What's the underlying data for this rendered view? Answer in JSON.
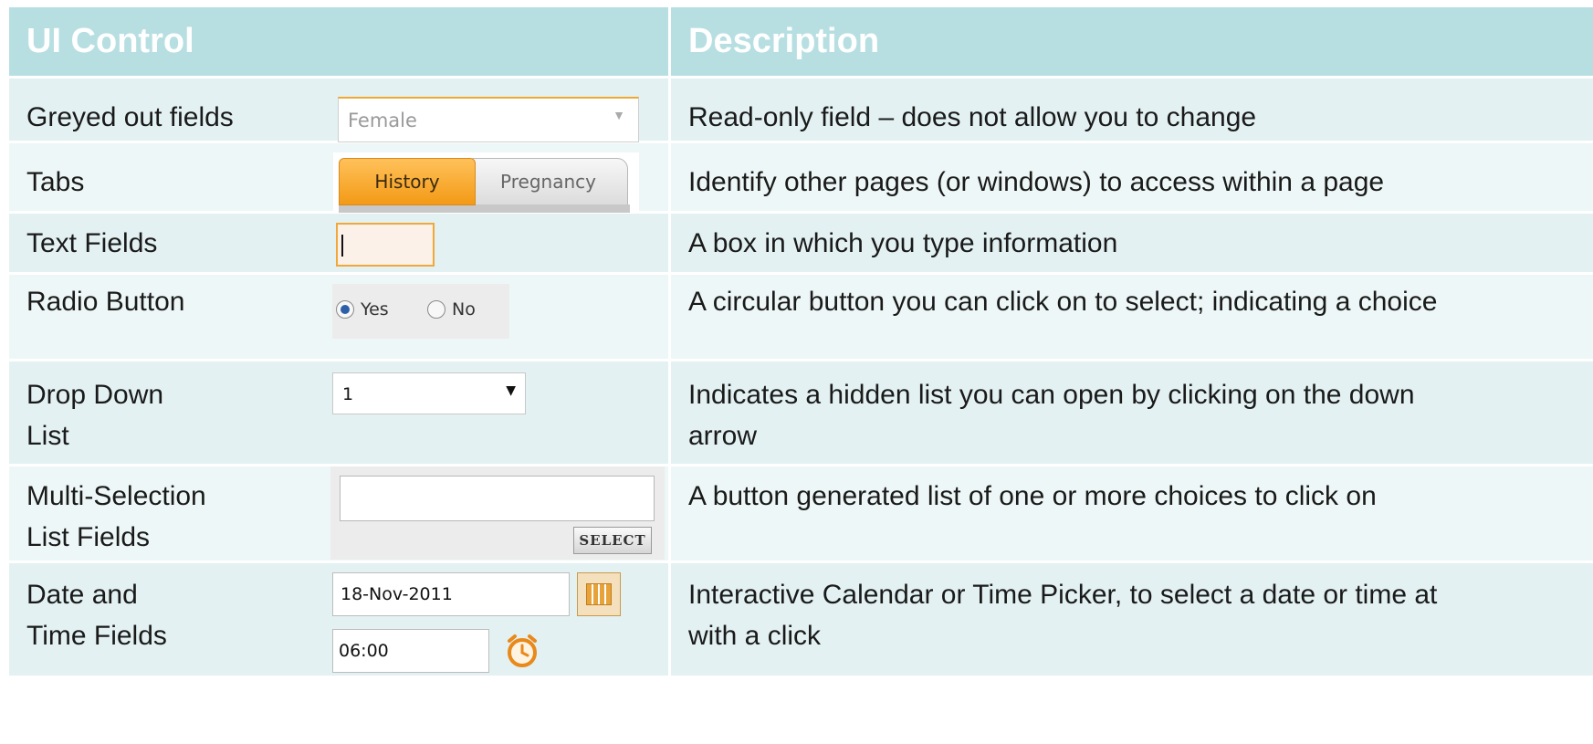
{
  "header": {
    "col1": "UI Control",
    "col2": "Description"
  },
  "rows": [
    {
      "label": "Greyed out fields",
      "desc": "Read-only field – does not allow you to change",
      "widget": {
        "value": "Female",
        "icon": "chevron-down-icon"
      }
    },
    {
      "label": "Tabs",
      "desc": "Identify other pages (or windows) to access within a page",
      "widget": {
        "tab1": "History",
        "tab2": "Pregnancy"
      }
    },
    {
      "label": "Text Fields",
      "desc": "A box in which you type information",
      "widget": {
        "value": ""
      }
    },
    {
      "label": "Radio Button",
      "desc": "A circular button you can click on to select; indicating a choice",
      "widget": {
        "opt1": "Yes",
        "opt2": "No"
      }
    },
    {
      "label_line1": "Drop Down",
      "label_line2": "List",
      "desc_line1": "Indicates a hidden list you can open by clicking on the down",
      "desc_line2": "arrow",
      "widget": {
        "value": "1",
        "icon": "caret-down-icon"
      }
    },
    {
      "label_line1": "Multi-Selection",
      "label_line2": "List Fields",
      "desc": "A button generated list of one or more choices to click on",
      "widget": {
        "button": "SELECT"
      }
    },
    {
      "label_line1": "Date and",
      "label_line2": "Time Fields",
      "desc_line1": "Interactive Calendar or Time Picker, to select a date or time at",
      "desc_line2": "with a click",
      "widget": {
        "date": "18-Nov-2011",
        "time": "06:00",
        "cal_icon": "calendar-icon",
        "clock_icon": "alarm-clock-icon"
      }
    }
  ],
  "colors": {
    "header_bg": "#b7dfe2",
    "row_a": "#e3f1f2",
    "row_b": "#eef7f7",
    "accent": "#f39a16"
  }
}
